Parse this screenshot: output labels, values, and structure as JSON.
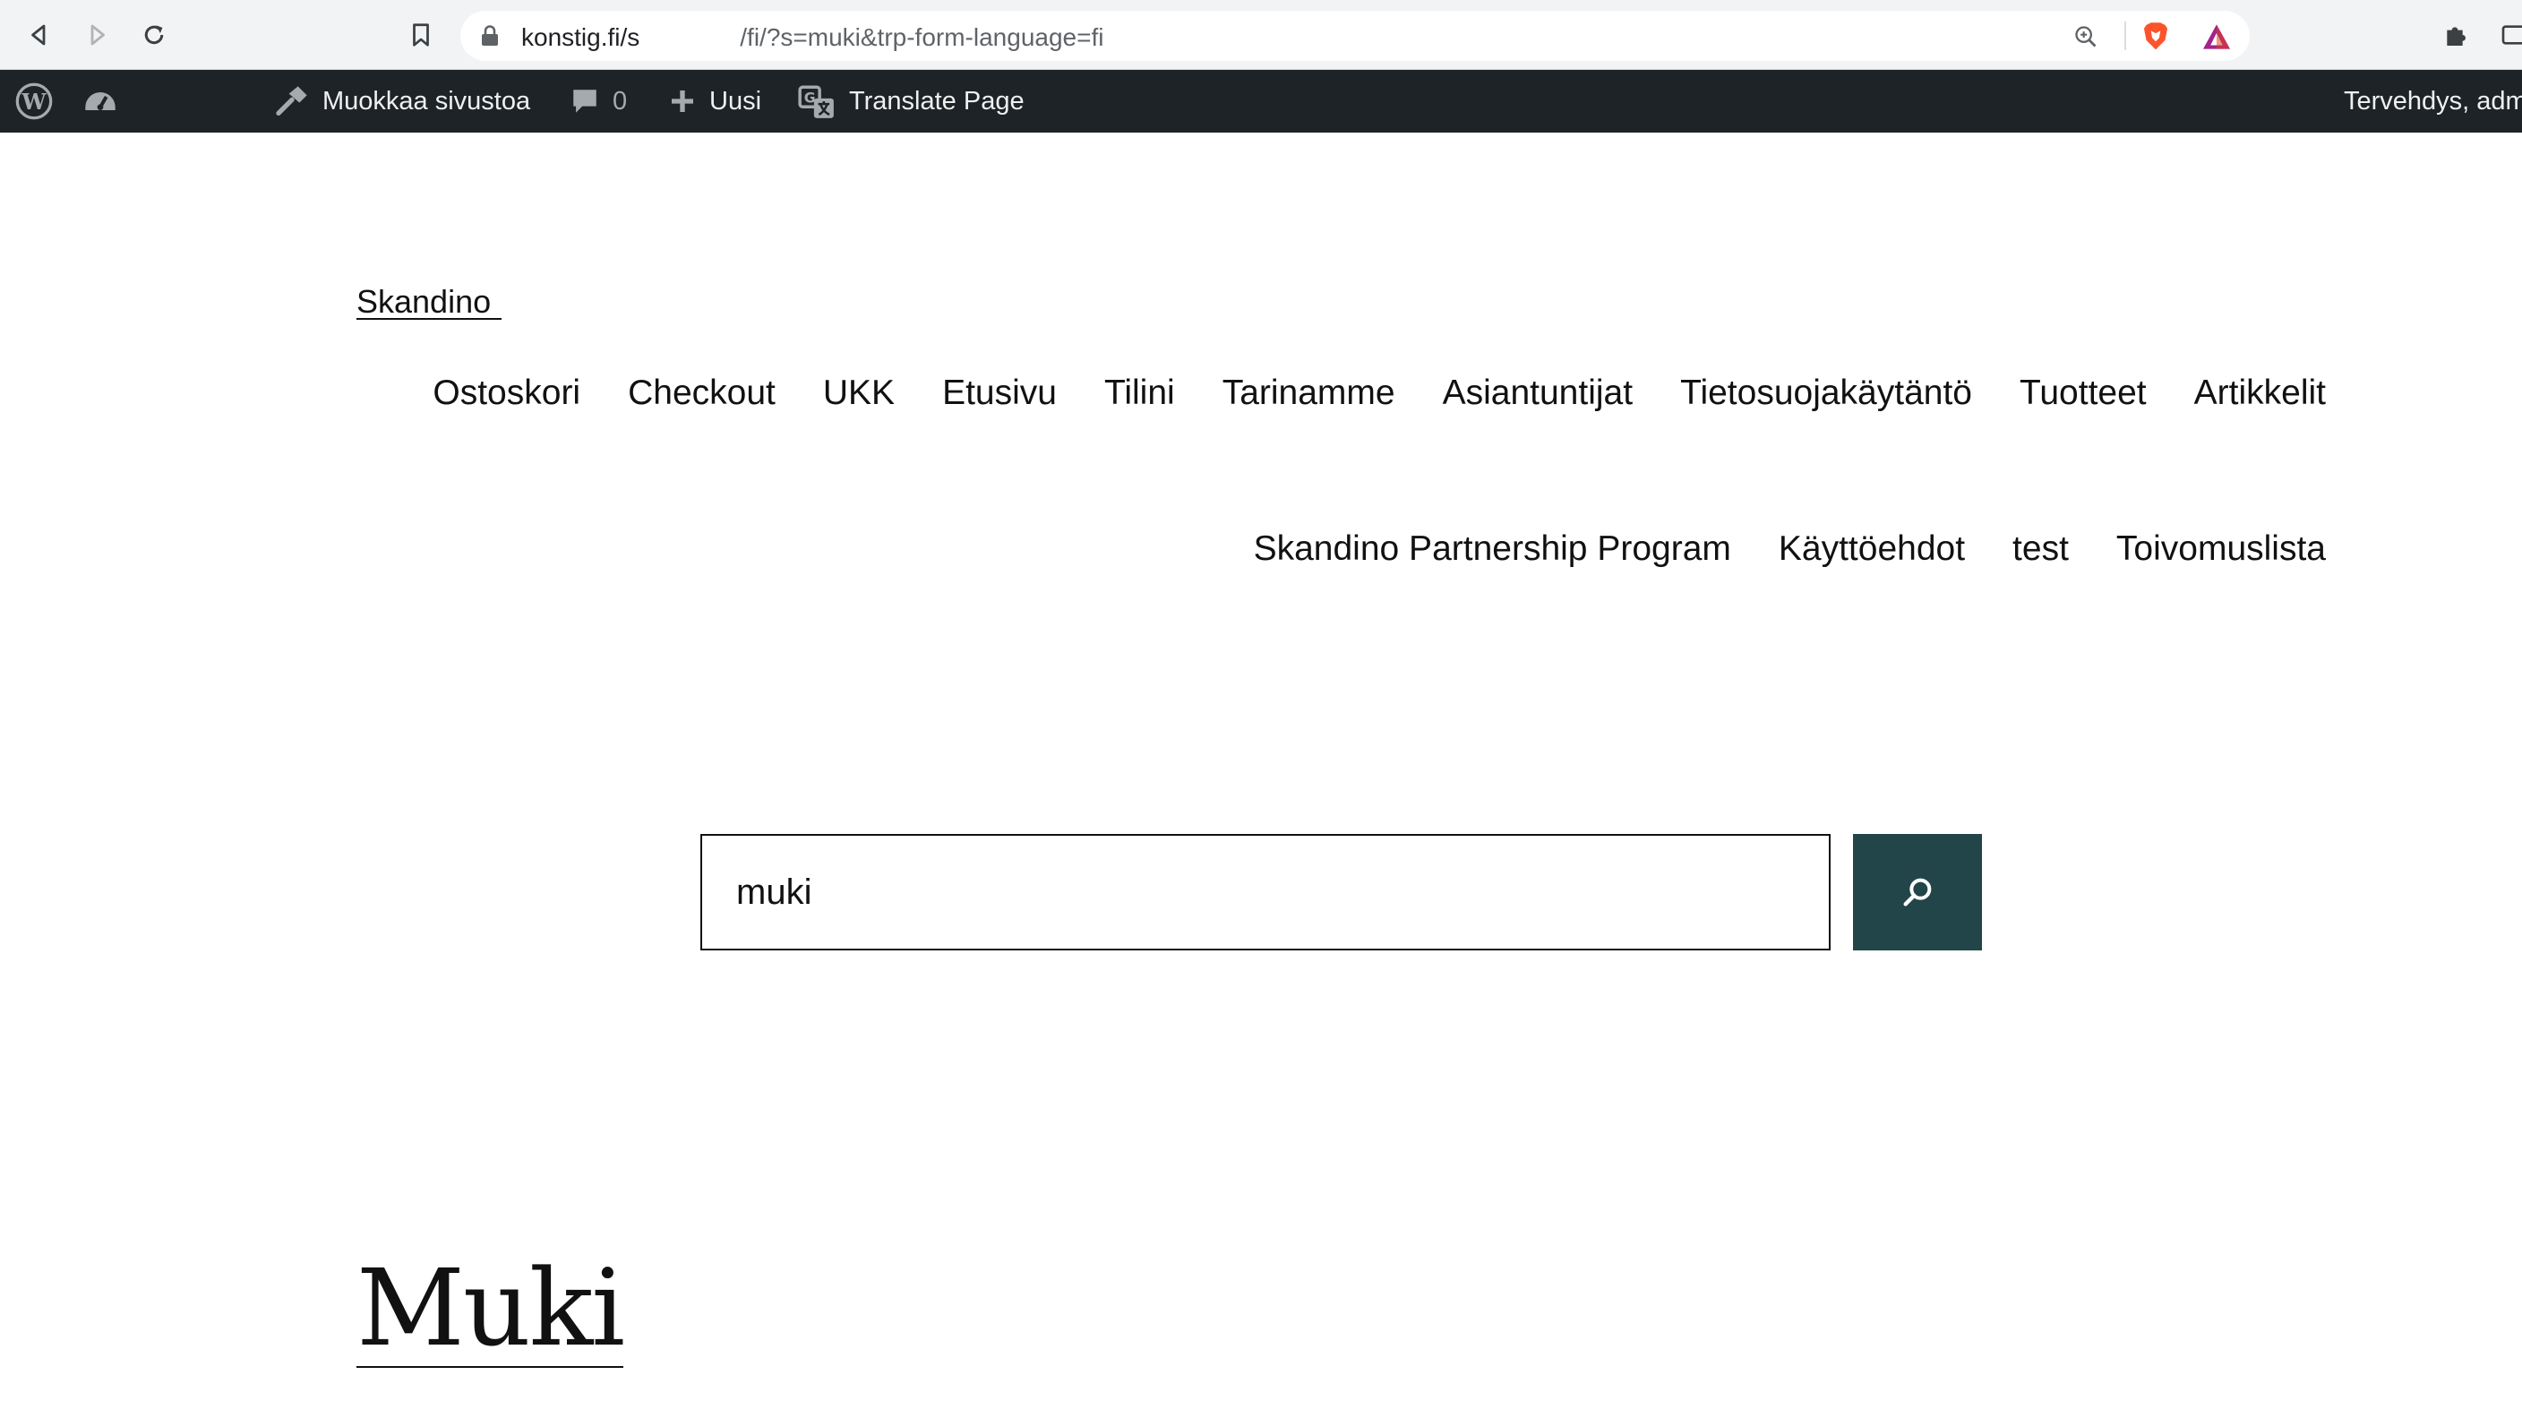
{
  "browser": {
    "url_host": "konstig.fi/s",
    "url_path": "/fi/?s=muki&trp-form-language=fi"
  },
  "admin_bar": {
    "edit_site_label": "Muokkaa sivustoa",
    "comments_count": "0",
    "new_label": "Uusi",
    "translate_label": "Translate Page",
    "greeting": "Tervehdys, adm"
  },
  "site": {
    "title_partial": "Skandino"
  },
  "navigation": {
    "row1": [
      "Ostoskori",
      "Checkout",
      "UKK",
      "Etusivu",
      "Tilini",
      "Tarinamme",
      "Asiantuntijat",
      "Tietosuojakäytäntö",
      "Tuotteet",
      "Artikkelit"
    ],
    "row2": [
      "Skandino Partnership Program",
      "Käyttöehdot",
      "test",
      "Toivomuslista"
    ]
  },
  "search": {
    "value": "muki",
    "button_color": "#224549"
  },
  "results": {
    "first_title": "Muki"
  }
}
